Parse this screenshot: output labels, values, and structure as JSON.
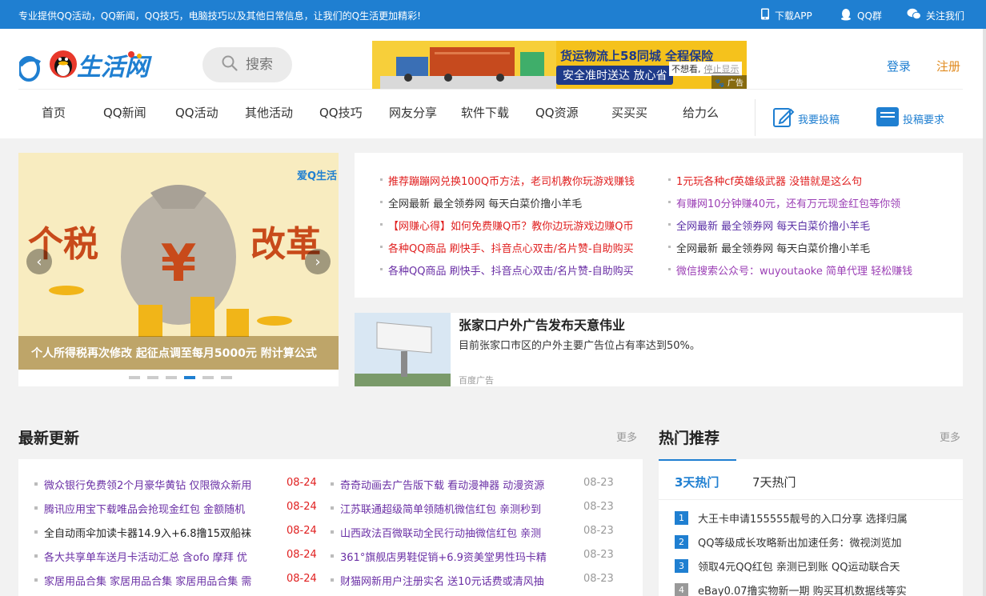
{
  "topbar": {
    "slogan": "专业提供QQ活动，QQ新闻，QQ技巧，电脑技巧以及其他日常信息，让我们的Q生活更加精彩!",
    "download_app": "下载APP",
    "qq_group": "QQ群",
    "follow": "关注我们"
  },
  "header": {
    "logo_text": "爱Q生活网",
    "search_placeholder": "搜索",
    "login": "登录",
    "register": "注册"
  },
  "banner_ad": {
    "line1": "货运物流上58同城 全程保险",
    "line2": "安全准时送达  放心省",
    "not_interested": "不想看,",
    "close": "停止显示",
    "tag": "广告"
  },
  "nav": {
    "items": [
      "首页",
      "QQ新闻",
      "QQ活动",
      "其他活动",
      "QQ技巧",
      "网友分享",
      "软件下载",
      "QQ资源",
      "买买买",
      "给力么"
    ],
    "submit": "我要投稿",
    "requirements": "投稿要求"
  },
  "slider": {
    "headline_left": "个税",
    "headline_right": "改革",
    "watermark": "爱Q生活",
    "caption": "个人所得税再次修改 起征点调至每月5000元 附计算公式",
    "dot_count": 6,
    "active_dot": 4
  },
  "headlines": {
    "left": [
      {
        "text": "推荐蹦蹦网兑换100Q币方法，老司机教你玩游戏赚钱",
        "color": "#e02020"
      },
      {
        "text": "全网最新 最全领券网 每天白菜价撸小羊毛",
        "color": "#333333"
      },
      {
        "text": "【网赚心得】如何免费赚Q币？教你边玩游戏边赚Q币",
        "color": "#e02020"
      },
      {
        "text": "各种QQ商品 刷快手、抖音点心双击/名片赞-自助购买",
        "color": "#e02020"
      },
      {
        "text": "各种QQ商品 刷快手、抖音点心双击/名片赞-自助购买",
        "color": "#6a2fa5"
      }
    ],
    "right": [
      {
        "text": "1元玩各种cf英雄级武器 没错就是这么句",
        "color": "#e02020"
      },
      {
        "text": "有赚网10分钟赚40元，还有万元现金红包等你领",
        "color": "#9b3fb5"
      },
      {
        "text": "全网最新 最全领券网 每天白菜价撸小羊毛",
        "color": "#5a2fa5"
      },
      {
        "text": "全网最新 最全领券网 每天白菜价撸小羊毛",
        "color": "#333333"
      },
      {
        "text": "微信搜索公众号：wuyoutaoke 简单代理 轻松赚钱",
        "color": "#9b3fb5"
      }
    ]
  },
  "baidu_ad": {
    "title": "张家口户外广告发布天意伟业",
    "desc": "目前张家口市区的户外主要广告位占有率达到50%。",
    "source": "百度广告"
  },
  "latest": {
    "title": "最新更新",
    "more": "更多",
    "left": [
      {
        "text": "微众银行免费领2个月豪华黄钻 仅限微众新用",
        "date": "08-24",
        "color": "#6a2fa5"
      },
      {
        "text": "腾讯应用宝下载唯品会抢现金红包 金额随机",
        "date": "08-24",
        "color": "#6a2fa5"
      },
      {
        "text": "全自动雨伞加读卡器14.9入+6.8撸15双船袜",
        "date": "08-24",
        "color": "#222222"
      },
      {
        "text": "各大共享单车送月卡活动汇总 含ofo 摩拜 优",
        "date": "08-24",
        "color": "#6a2fa5"
      },
      {
        "text": "家居用品合集 家居用品合集 家居用品合集 需",
        "date": "08-24",
        "color": "#6a2fa5"
      }
    ],
    "right": [
      {
        "text": "奇奇动画去广告版下载 看动漫神器 动漫资源",
        "date": "08-23",
        "color": "#6a2fa5"
      },
      {
        "text": "江苏联通超级简单领随机微信红包 亲测秒到",
        "date": "08-23",
        "color": "#6a2fa5"
      },
      {
        "text": "山西政法百微联动全民行动抽微信红包 亲测",
        "date": "08-23",
        "color": "#6a2fa5"
      },
      {
        "text": "361°旗舰店男鞋促销+6.9资美堂男性玛卡精",
        "date": "08-23",
        "color": "#6a2fa5"
      },
      {
        "text": "财猫网新用户注册实名 送10元话费或清风抽",
        "date": "08-23",
        "color": "#6a2fa5"
      }
    ]
  },
  "hot": {
    "title": "热门推荐",
    "more": "更多",
    "tab1": "3天热门",
    "tab2": "7天热门",
    "items": [
      {
        "num": "1",
        "text": "大王卡申请155555靓号的入口分享 选择归属"
      },
      {
        "num": "2",
        "text": "QQ等级成长攻略新出加速任务：微视浏览加"
      },
      {
        "num": "3",
        "text": "领取4元QQ红包 亲测已到账 QQ运动联合天"
      },
      {
        "num": "4",
        "text": "eBay0.07撸实物新一期 购买耳机数据线等实"
      }
    ]
  },
  "colors": {
    "brand_blue": "#1f7fd1",
    "date_red": "#e02020",
    "date_gray": "#999999",
    "register_orange": "#e08a1e"
  }
}
